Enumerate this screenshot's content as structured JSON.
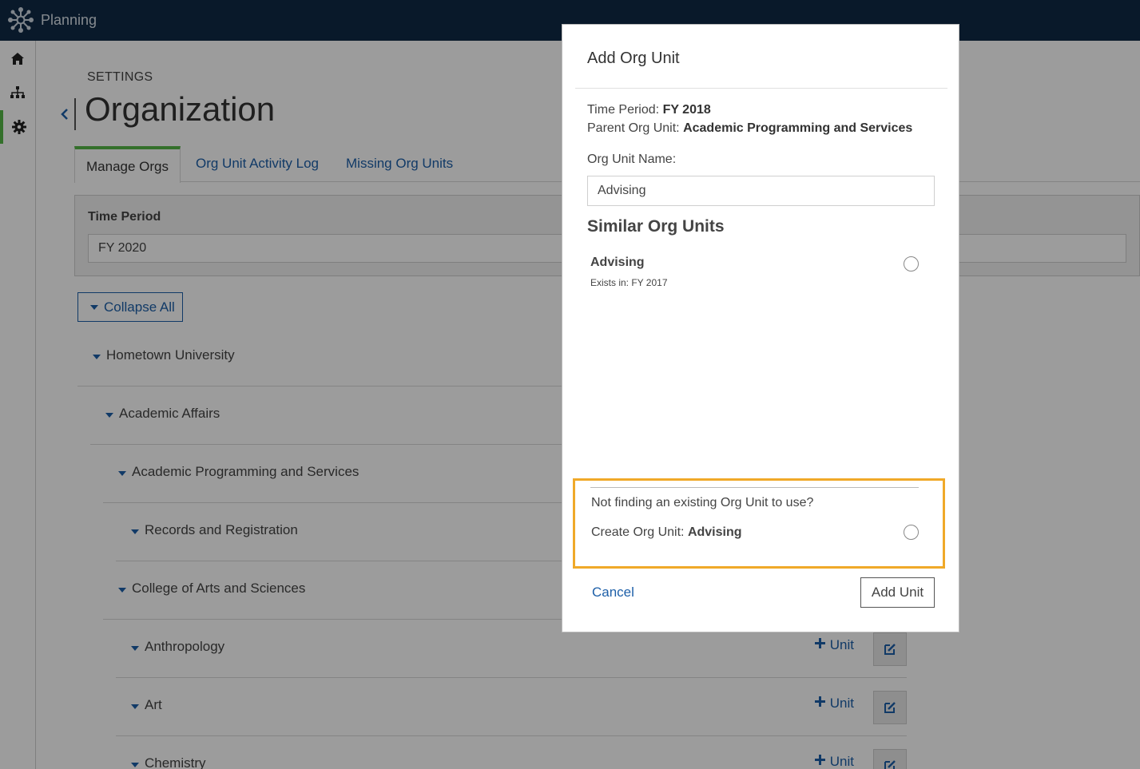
{
  "app": {
    "title": "Planning"
  },
  "rail": {
    "items": [
      "home-icon",
      "org-chart-icon",
      "gear-icon"
    ],
    "active_color": "#56b847"
  },
  "page": {
    "crumb": "SETTINGS",
    "title": "Organization"
  },
  "tabs": [
    {
      "label": "Manage Orgs",
      "active": true
    },
    {
      "label": "Org Unit Activity Log",
      "active": false
    },
    {
      "label": "Missing Org Units",
      "active": false
    }
  ],
  "time_period": {
    "label": "Time Period",
    "value": "FY 2020"
  },
  "collapse_label": "Collapse All",
  "tree": [
    {
      "label": "Hometown University"
    },
    {
      "label": "Academic Affairs"
    },
    {
      "label": "Academic Programming and Services"
    },
    {
      "label": "Records and Registration"
    },
    {
      "label": "College of Arts and Sciences"
    },
    {
      "label": "Anthropology",
      "unit_label": "Unit"
    },
    {
      "label": "Art",
      "unit_label": "Unit"
    },
    {
      "label": "Chemistry",
      "unit_label": "Unit"
    }
  ],
  "modal": {
    "title": "Add Org Unit",
    "time_period_label": "Time Period:",
    "time_period_value": "FY 2018",
    "parent_label": "Parent Org Unit:",
    "parent_value": "Academic Programming and Services",
    "name_label": "Org Unit Name:",
    "name_value": "Advising",
    "similar_title": "Similar Org Units",
    "similar": [
      {
        "name": "Advising",
        "exists": "Exists in: FY 2017"
      }
    ],
    "create_question": "Not finding an existing Org Unit to use?",
    "create_label": "Create Org Unit:",
    "create_value": "Advising",
    "cancel_label": "Cancel",
    "add_label": "Add Unit",
    "highlight_color": "#f0a929"
  }
}
